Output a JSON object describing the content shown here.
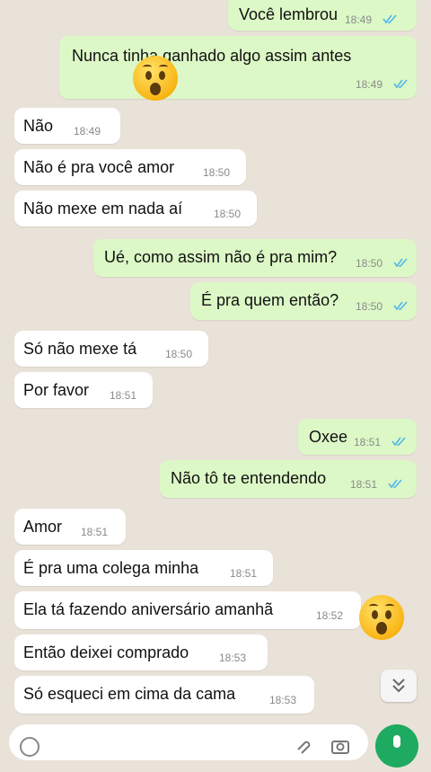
{
  "messages": [
    {
      "dir": "out",
      "text": "Você lembrou",
      "time": "18:49",
      "ticks": "read"
    },
    {
      "dir": "out",
      "text": "Nunca tinha ganhado algo assim antes",
      "time": "18:49",
      "ticks": "read"
    },
    {
      "dir": "in",
      "text": "Não",
      "time": "18:49"
    },
    {
      "dir": "in",
      "text": "Não é pra você amor",
      "time": "18:50"
    },
    {
      "dir": "in",
      "text": "Não mexe em nada aí",
      "time": "18:50"
    },
    {
      "dir": "out",
      "text": "Ué, como assim não é pra mim?",
      "time": "18:50",
      "ticks": "read"
    },
    {
      "dir": "out",
      "text": "É pra quem então?",
      "time": "18:50",
      "ticks": "read"
    },
    {
      "dir": "in",
      "text": "Só não mexe tá",
      "time": "18:50"
    },
    {
      "dir": "in",
      "text": "Por favor",
      "time": "18:51"
    },
    {
      "dir": "out",
      "text": "Oxee",
      "time": "18:51",
      "ticks": "read"
    },
    {
      "dir": "out",
      "text": "Não tô te entendendo",
      "time": "18:51",
      "ticks": "read"
    },
    {
      "dir": "in",
      "text": "Amor",
      "time": "18:51"
    },
    {
      "dir": "in",
      "text": "É pra uma colega minha",
      "time": "18:51"
    },
    {
      "dir": "in",
      "text": "Ela tá fazendo aniversário amanhã",
      "time": "18:52"
    },
    {
      "dir": "in",
      "text": "Então deixei comprado",
      "time": "18:53"
    },
    {
      "dir": "in",
      "text": "Só esqueci em cima da cama",
      "time": "18:53"
    }
  ],
  "overlay_emojis": [
    "astonished-face",
    "astonished-face"
  ],
  "icons": {
    "scroll_down": "double-chevron-down-icon",
    "mic": "microphone-icon",
    "attach": "paperclip-icon",
    "camera": "camera-icon"
  },
  "colors": {
    "incoming": "#ffffff",
    "outgoing": "#dcf8c6",
    "read_tick": "#4fb6ec",
    "background": "#e9e2d8",
    "send_button": "#1eaa61"
  }
}
